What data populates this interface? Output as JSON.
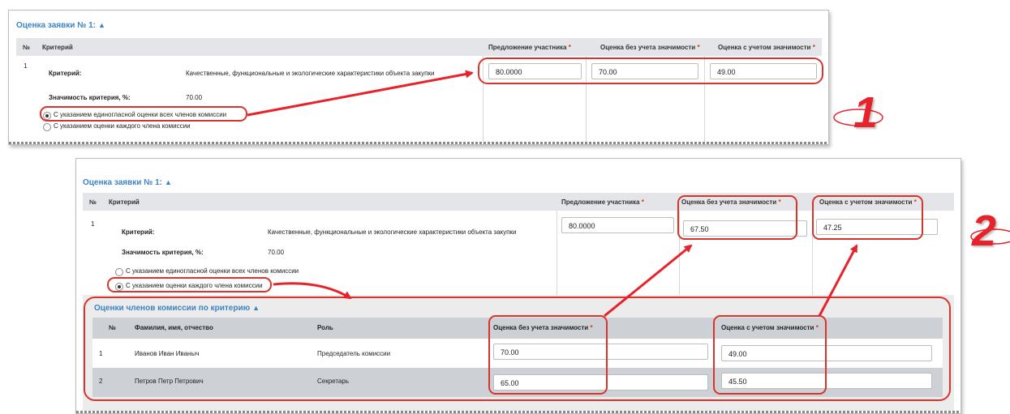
{
  "section_title": "Оценка заявки № 1:",
  "table_headers": {
    "num": "№",
    "criterion": "Критерий",
    "offer": "Предложение участника",
    "score_without": "Оценка без учета значимости",
    "score_with": "Оценка с учетом значимости",
    "required_mark": "*"
  },
  "row_number": "1",
  "criterion_label": "Критерий:",
  "criterion_value": "Качественные, функциональные и экологические характеристики объекта закупки",
  "weight_label": "Значимость критерия, %:",
  "weight_value": "70.00",
  "radio_unanimous": "С указанием единогласной оценки всех членов комиссии",
  "radio_each_member": "С указанием оценки каждого члена комиссии",
  "panel1": {
    "offer_value": "80.0000",
    "score_without": "70.00",
    "score_with": "49.00",
    "selected_radio": "unanimous",
    "callout": "1"
  },
  "panel2": {
    "offer_value": "80.0000",
    "score_without": "67.50",
    "score_with": "47.25",
    "selected_radio": "each_member",
    "callout": "2",
    "members_title": "Оценки членов комиссии по критерию",
    "members_headers": {
      "num": "№",
      "name": "Фамилия, имя, отчество",
      "role": "Роль",
      "score_without": "Оценка без учета значимости",
      "score_with": "Оценка с учетом значимости"
    },
    "members": [
      {
        "num": "1",
        "name": "Иванов Иван Иваныч",
        "role": "Председатель комиссии",
        "score_without": "70.00",
        "score_with": "49.00"
      },
      {
        "num": "2",
        "name": "Петров Петр Петрович",
        "role": "Секретарь",
        "score_without": "65.00",
        "score_with": "45.50"
      }
    ]
  },
  "colors": {
    "accent": "#3a83c4",
    "annotation": "#d9342b",
    "required": "#d9342b"
  }
}
